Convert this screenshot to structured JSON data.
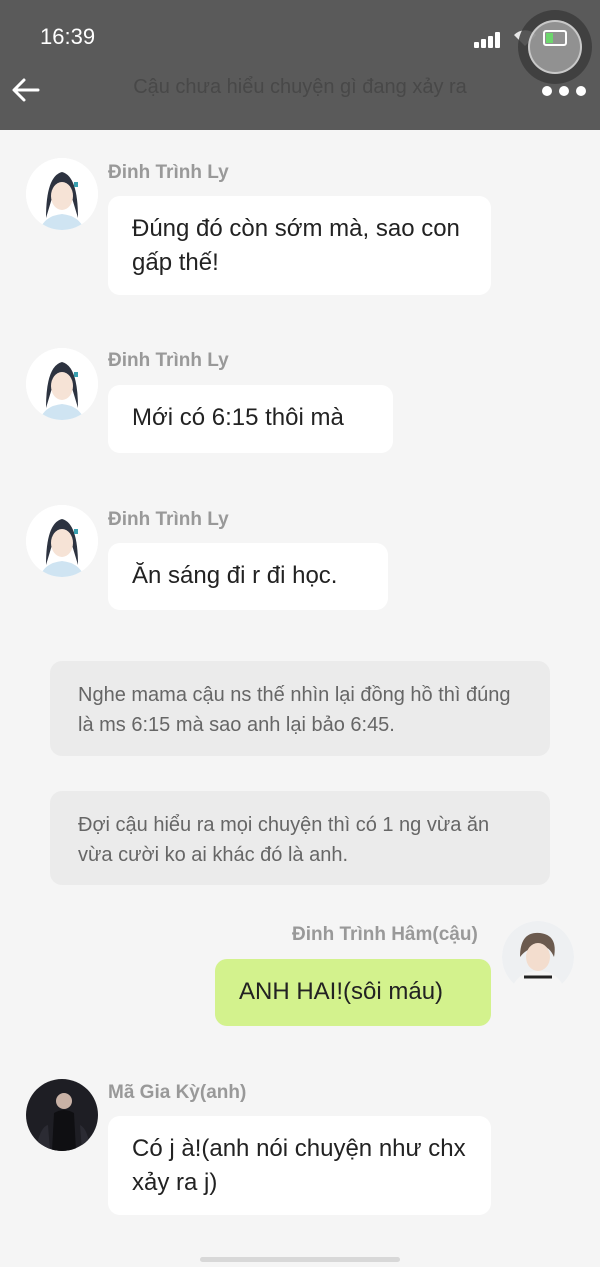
{
  "status_bar": {
    "time": "16:39"
  },
  "header": {
    "title": "Cậu chưa hiểu chuyện gì đang xảy ra"
  },
  "messages": [
    {
      "sender": "Đinh Trình Ly",
      "text": "Đúng đó còn sớm mà, sao con gấp thế!"
    },
    {
      "sender": "Đinh Trình Ly",
      "text": "Mới có 6:15 thôi mà"
    },
    {
      "sender": "Đinh Trình Ly",
      "text": "Ăn sáng đi r đi học."
    },
    {
      "text": "Nghe mama cậu ns thế nhìn lại đồng hồ thì đúng là ms 6:15 mà sao anh lại bảo 6:45."
    },
    {
      "text": "Đợi cậu hiểu ra mọi chuyện thì có 1 ng vừa ăn vừa cười ko ai khác đó là anh."
    },
    {
      "sender": "Đinh Trình Hâm(cậu)",
      "text": "ANH HAI!(sôi máu)"
    },
    {
      "sender": "Mã Gia Kỳ(anh)",
      "text": "Có j à!(anh nói chuyện như chx xảy ra j)"
    }
  ],
  "colors": {
    "header_bg": "#5a5a5a",
    "page_bg": "#f5f5f5",
    "own_bubble": "#d3f28d",
    "narration_bg": "#ebebeb"
  }
}
